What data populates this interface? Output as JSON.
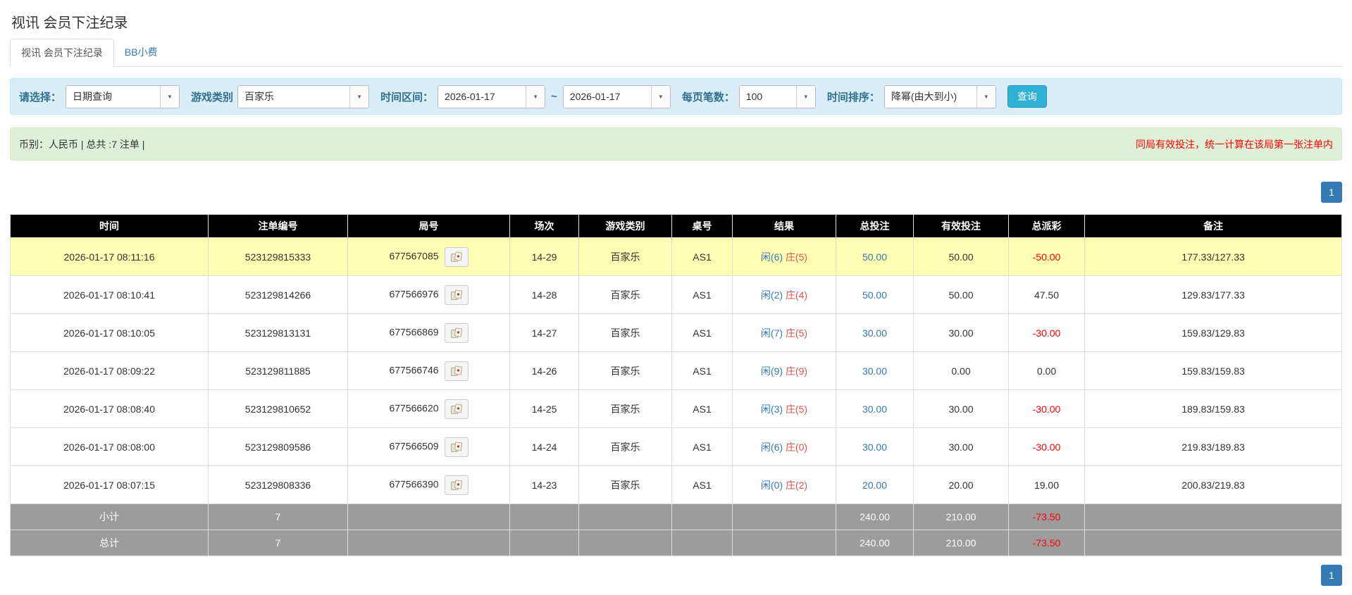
{
  "page": {
    "title": "视讯 会员下注纪录"
  },
  "tabs": [
    {
      "label": "视讯 会员下注纪录"
    },
    {
      "label": "BB小费"
    }
  ],
  "filters": {
    "select_label": "请选择：",
    "select_value": "日期查询",
    "game_type_label": "游戏类别",
    "game_type_value": "百家乐",
    "date_range_label": "时间区间：",
    "date_from": "2026-01-17",
    "date_separator": "~",
    "date_to": "2026-01-17",
    "page_size_label": "每页笔数：",
    "page_size_value": "100",
    "sort_label": "时间排序：",
    "sort_value": "降幂(由大到小)",
    "search_button_label": "查询"
  },
  "summary": {
    "left_text": "币别：人民币 | 总共 :7 注单 |",
    "right_notice": "同局有效投注，统一计算在该局第一张注单内"
  },
  "pagination": {
    "current_page": "1"
  },
  "colors": {
    "accent_blue": "#337ab7",
    "negative_red": "#ff0000",
    "highlight_row": "#ffffb3",
    "header_bg": "#000000",
    "filter_bar_bg": "#d9edf7",
    "summary_bar_bg": "#dff0d8",
    "subtotal_bg": "#9c9c9c",
    "search_button_bg": "#31b0d5"
  },
  "icons": {
    "dropdown": "caret-down-icon",
    "round_detail": "cards-icon"
  },
  "table": {
    "headers": [
      "时间",
      "注单编号",
      "局号",
      "场次",
      "游戏类别",
      "桌号",
      "结果",
      "总投注",
      "有效投注",
      "总派彩",
      "备注"
    ],
    "rows": [
      {
        "time": "2026-01-17 08:11:16",
        "bet_id": "523129815333",
        "round_id": "677567085",
        "session": "14-29",
        "game": "百家乐",
        "table_no": "AS1",
        "result_player": "闲(6)",
        "result_banker": "庄(5)",
        "total_bet": "50.00",
        "valid_bet": "50.00",
        "payout": "-50.00",
        "note": "177.33/127.33",
        "highlight": true
      },
      {
        "time": "2026-01-17 08:10:41",
        "bet_id": "523129814266",
        "round_id": "677566976",
        "session": "14-28",
        "game": "百家乐",
        "table_no": "AS1",
        "result_player": "闲(2)",
        "result_banker": "庄(4)",
        "total_bet": "50.00",
        "valid_bet": "50.00",
        "payout": "47.50",
        "note": "129.83/177.33",
        "highlight": false
      },
      {
        "time": "2026-01-17 08:10:05",
        "bet_id": "523129813131",
        "round_id": "677566869",
        "session": "14-27",
        "game": "百家乐",
        "table_no": "AS1",
        "result_player": "闲(7)",
        "result_banker": "庄(5)",
        "total_bet": "30.00",
        "valid_bet": "30.00",
        "payout": "-30.00",
        "note": "159.83/129.83",
        "highlight": false
      },
      {
        "time": "2026-01-17 08:09:22",
        "bet_id": "523129811885",
        "round_id": "677566746",
        "session": "14-26",
        "game": "百家乐",
        "table_no": "AS1",
        "result_player": "闲(9)",
        "result_banker": "庄(9)",
        "total_bet": "30.00",
        "valid_bet": "0.00",
        "payout": "0.00",
        "note": "159.83/159.83",
        "highlight": false
      },
      {
        "time": "2026-01-17 08:08:40",
        "bet_id": "523129810652",
        "round_id": "677566620",
        "session": "14-25",
        "game": "百家乐",
        "table_no": "AS1",
        "result_player": "闲(3)",
        "result_banker": "庄(5)",
        "total_bet": "30.00",
        "valid_bet": "30.00",
        "payout": "-30.00",
        "note": "189.83/159.83",
        "highlight": false
      },
      {
        "time": "2026-01-17 08:08:00",
        "bet_id": "523129809586",
        "round_id": "677566509",
        "session": "14-24",
        "game": "百家乐",
        "table_no": "AS1",
        "result_player": "闲(6)",
        "result_banker": "庄(0)",
        "total_bet": "30.00",
        "valid_bet": "30.00",
        "payout": "-30.00",
        "note": "219.83/189.83",
        "highlight": false
      },
      {
        "time": "2026-01-17 08:07:15",
        "bet_id": "523129808336",
        "round_id": "677566390",
        "session": "14-23",
        "game": "百家乐",
        "table_no": "AS1",
        "result_player": "闲(0)",
        "result_banker": "庄(2)",
        "total_bet": "20.00",
        "valid_bet": "20.00",
        "payout": "19.00",
        "note": "200.83/219.83",
        "highlight": false
      }
    ],
    "subtotal": {
      "label": "小计",
      "count": "7",
      "total_bet": "240.00",
      "valid_bet": "210.00",
      "payout": "-73.50"
    },
    "total": {
      "label": "总计",
      "count": "7",
      "total_bet": "240.00",
      "valid_bet": "210.00",
      "payout": "-73.50"
    }
  }
}
